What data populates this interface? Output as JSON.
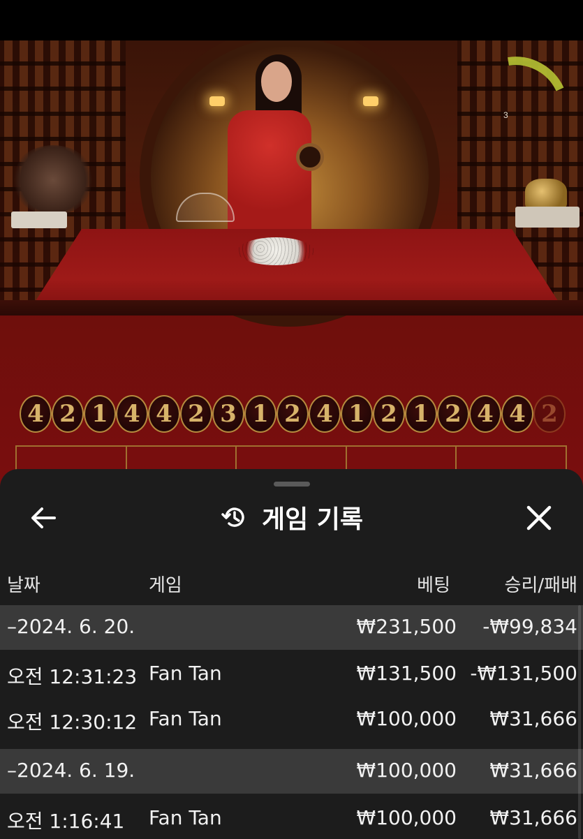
{
  "video": {
    "timer_value": "3",
    "results": [
      "4",
      "2",
      "1",
      "4",
      "4",
      "2",
      "3",
      "1",
      "2",
      "4",
      "1",
      "2",
      "1",
      "2",
      "4",
      "4",
      "2"
    ],
    "bet_area_labels": [
      "",
      "",
      "",
      "",
      ""
    ]
  },
  "sheet": {
    "title": "게임 기록",
    "back_icon": "arrow-left-icon",
    "history_icon": "history-icon",
    "close_icon": "close-icon"
  },
  "table": {
    "headers": {
      "date": "날짜",
      "game": "게임",
      "bet": "베팅",
      "win_loss": "승리/패배"
    },
    "rows": [
      {
        "type": "date",
        "date": "–2024. 6. 20.",
        "game": "",
        "bet": "₩231,500",
        "win_loss": "-₩99,834"
      },
      {
        "type": "entry",
        "date": "오전 12:31:23",
        "game": "Fan Tan",
        "bet": "₩131,500",
        "win_loss": "-₩131,500"
      },
      {
        "type": "entry",
        "date": "오전 12:30:12",
        "game": "Fan Tan",
        "bet": "₩100,000",
        "win_loss": "₩31,666"
      },
      {
        "type": "date",
        "date": "–2024. 6. 19.",
        "game": "",
        "bet": "₩100,000",
        "win_loss": "₩31,666"
      },
      {
        "type": "entry",
        "date": "오전 1:16:41",
        "game": "Fan Tan",
        "bet": "₩100,000",
        "win_loss": "₩31,666"
      }
    ]
  },
  "colors": {
    "sheet_bg": "#1c1c1c",
    "date_row_bg": "#3a3a3a",
    "bead_gold": "#d7b36a",
    "timer_green": "#b6c234"
  }
}
